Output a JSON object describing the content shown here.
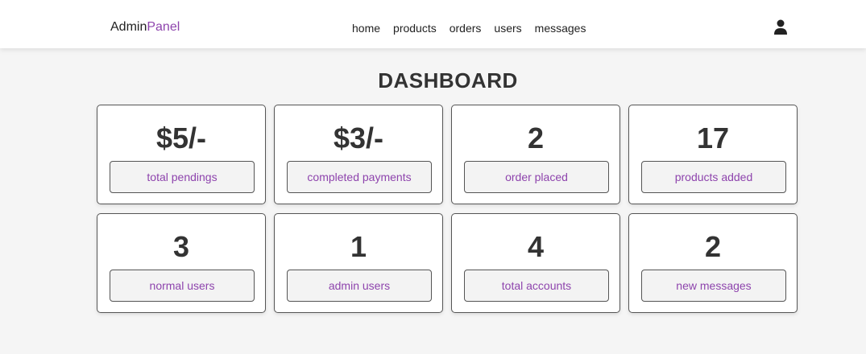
{
  "header": {
    "logo_main": "Admin",
    "logo_accent": "Panel",
    "nav": [
      "home",
      "products",
      "orders",
      "users",
      "messages"
    ],
    "user_icon": "user-icon"
  },
  "dashboard": {
    "title": "DASHBOARD",
    "cards": [
      {
        "value": "$5/-",
        "label": "total pendings"
      },
      {
        "value": "$3/-",
        "label": "completed payments"
      },
      {
        "value": "2",
        "label": "order placed"
      },
      {
        "value": "17",
        "label": "products added"
      },
      {
        "value": "3",
        "label": "normal users"
      },
      {
        "value": "1",
        "label": "admin users"
      },
      {
        "value": "4",
        "label": "total accounts"
      },
      {
        "value": "2",
        "label": "new messages"
      }
    ]
  },
  "colors": {
    "accent": "#8e44ad",
    "text": "#333333",
    "background": "#f5f5f5"
  }
}
